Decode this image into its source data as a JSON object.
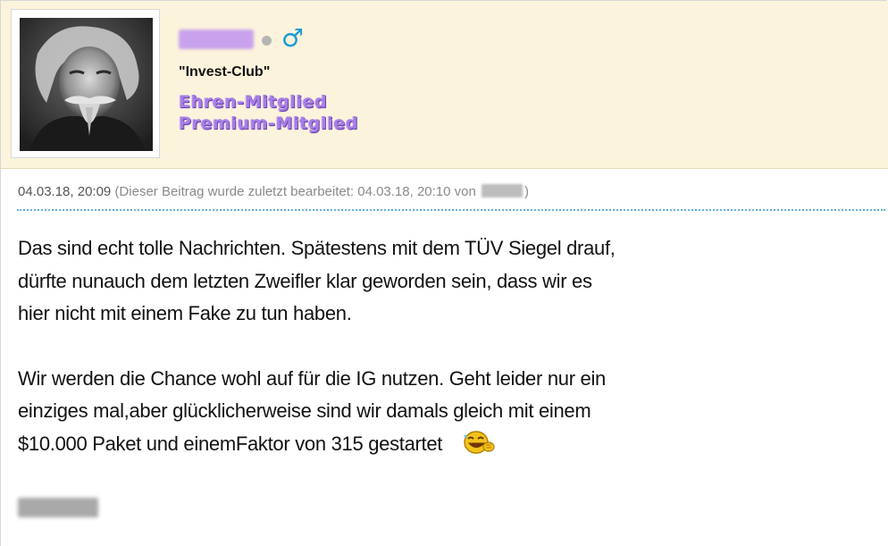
{
  "user": {
    "title": "\"Invest-Club\"",
    "gender_symbol": "♂",
    "status": "offline",
    "ranks": [
      "Ehren-Mitglied",
      "Premium-Mitglied"
    ]
  },
  "post": {
    "timestamp": "04.03.18, 20:09",
    "edit_note_prefix": "(Dieser Beitrag wurde zuletzt bearbeitet: 04.03.18, 20:10 von",
    "edit_note_suffix": ")",
    "paragraphs": [
      "Das sind echt tolle Nachrichten. Spätestens mit dem TÜV Siegel drauf,\ndürfte nunauch dem letzten Zweifler klar geworden sein, dass wir es\nhier nicht mit einem Fake zu tun haben.",
      "Wir werden die Chance wohl auf für die IG nutzen. Geht leider nur ein\neinziges mal,aber glücklicherweise sind wir damals gleich mit einem\n$10.000 Paket und einemFaktor von 315 gestartet"
    ]
  },
  "icons": {
    "gender": "male-symbol-icon",
    "status": "offline-status-dot",
    "smiley": "laughing-smiley-icon"
  },
  "colors": {
    "header_bg": "#fcf3dc",
    "rank_purple": "#a77ee4",
    "gender_blue": "#1c9ad6",
    "divider_blue": "#5fb4d8"
  }
}
